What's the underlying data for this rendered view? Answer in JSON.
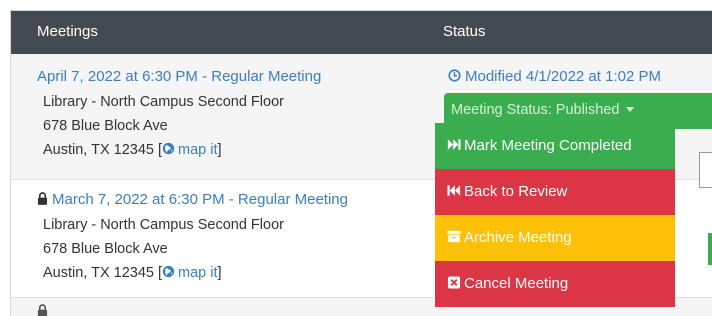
{
  "header": {
    "meetings": "Meetings",
    "status": "Status"
  },
  "meetings": [
    {
      "title": "April 7, 2022 at 6:30 PM - Regular Meeting",
      "location": "Library - North Campus Second Floor",
      "street": "678 Blue Block Ave",
      "city": "Austin, TX 12345 [",
      "map_link": "map it",
      "close": "]"
    },
    {
      "title": "March 7, 2022 at 6:30 PM - Regular Meeting",
      "location": "Library - North Campus Second Floor",
      "street": "678 Blue Block Ave",
      "city": "Austin, TX 12345 [",
      "map_link": "map it",
      "close": "]"
    }
  ],
  "status": {
    "modified": "Modified 4/1/2022 at 1:02 PM",
    "button_label": "Meeting Status: Published"
  },
  "menu": {
    "complete": "Mark Meeting Completed",
    "review": "Back to Review",
    "archive": "Archive Meeting",
    "cancel": "Cancel Meeting"
  },
  "icons": {
    "clock": "clock-icon",
    "globe": "globe-icon",
    "lock": "lock-icon",
    "fast-forward": "fast-forward-icon",
    "fast-backward": "fast-backward-icon",
    "archive": "archive-icon",
    "close-box": "close-box-icon"
  },
  "colors": {
    "header_bg": "#444a52",
    "link": "#3a7fc1",
    "success": "#3aae4e",
    "danger": "#dc3545",
    "warning": "#ffc107"
  }
}
